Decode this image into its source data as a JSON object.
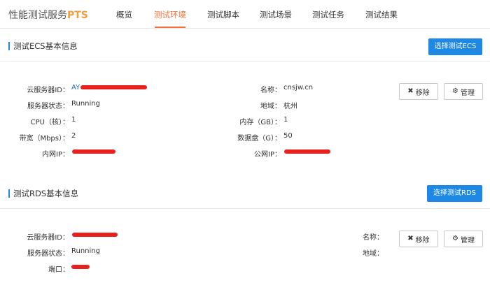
{
  "brand": {
    "name": "性能测试服务",
    "accent": "PTS"
  },
  "nav": {
    "tabs": [
      {
        "label": "概览"
      },
      {
        "label": "测试环境"
      },
      {
        "label": "测试脚本"
      },
      {
        "label": "测试场景"
      },
      {
        "label": "测试任务"
      },
      {
        "label": "测试结果"
      }
    ],
    "active_index": 1
  },
  "ecs": {
    "title": "测试ECS基本信息",
    "select_button": "选择测试ECS",
    "fields": {
      "server_id_label": "云服务器ID：",
      "server_id_value": "AY",
      "status_label": "服务器状态：",
      "status_value": "Running",
      "cpu_label": "CPU（核）：",
      "cpu_value": "1",
      "bandwidth_label": "带宽（Mbps）：",
      "bandwidth_value": "2",
      "private_ip_label": "内网IP：",
      "name_label": "名称：",
      "name_value": "cnsjw.cn",
      "region_label": "地域：",
      "region_value": "杭州",
      "memory_label": "内存（GB）：",
      "memory_value": "1",
      "disk_label": "数据盘（G）：",
      "disk_value": "50",
      "public_ip_label": "公网IP："
    },
    "remove_button": "移除",
    "manage_button": "管理"
  },
  "rds": {
    "title": "测试RDS基本信息",
    "select_button": "选择测试RDS",
    "fields": {
      "server_id_label": "云服务器ID：",
      "status_label": "服务器状态：",
      "status_value": "Running",
      "port_label": "端口：",
      "name_label": "名称：",
      "region_label": "地域："
    },
    "remove_button": "移除",
    "manage_button": "管理"
  },
  "icons": {
    "remove": "close-icon",
    "manage": "gear-icon"
  },
  "colors": {
    "primary": "#1e88e5",
    "active_tab": "#f26f3a",
    "brand_accent": "#f39c3c",
    "redaction": "#e8211f"
  }
}
